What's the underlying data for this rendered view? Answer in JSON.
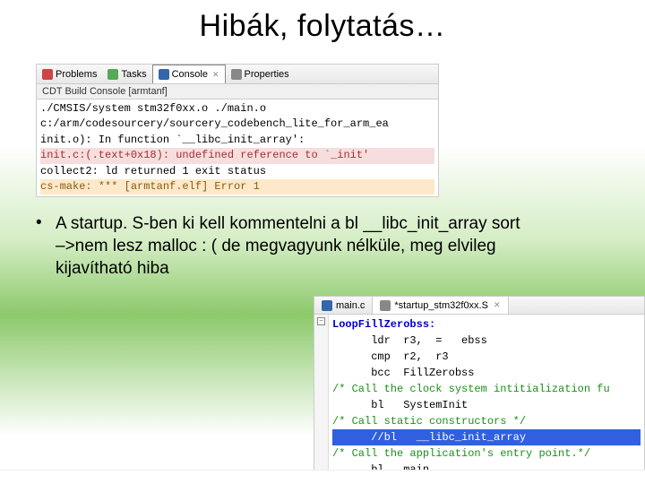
{
  "title": "Hibák, folytatás…",
  "console": {
    "tabs": {
      "problems": "Problems",
      "tasks": "Tasks",
      "console": "Console",
      "properties": "Properties"
    },
    "subtitle": "CDT Build Console [armtanf]",
    "lines": {
      "l0": "./CMSIS/system stm32f0xx.o  ./main.o",
      "l1": "c:/arm/codesourcery/sourcery_codebench_lite_for_arm_ea",
      "l2": "init.o): In function `__libc_init_array':",
      "l3": "init.c:(.text+0x18): undefined reference to `_init'",
      "l4": "collect2: ld returned 1 exit status",
      "l5": "cs-make: *** [armtanf.elf] Error 1"
    }
  },
  "bullet": {
    "line1": "A startup. S-ben ki kell kommentelni a bl __libc_init_array  sort",
    "line2": "–>nem lesz malloc : (  de megvagyunk nélküle, meg elvileg",
    "line3": "kijavítható hiba"
  },
  "code": {
    "tabs": {
      "main": "main.c",
      "startup": "*startup_stm32f0xx.S"
    },
    "lines": {
      "c0": "LoopFillZerobss:",
      "c1": "      ldr  r3,  =   ebss",
      "c2": "      cmp  r2,  r3",
      "c3": "      bcc  FillZerobss",
      "c4": "",
      "c5": "/* Call the clock system intitialization fu",
      "c6": "      bl   SystemInit",
      "c7": "/* Call static constructors */",
      "c8": "      //bl   __libc_init_array",
      "c9": "/* Call the application's entry point.*/",
      "c10": "      bl   main"
    }
  }
}
